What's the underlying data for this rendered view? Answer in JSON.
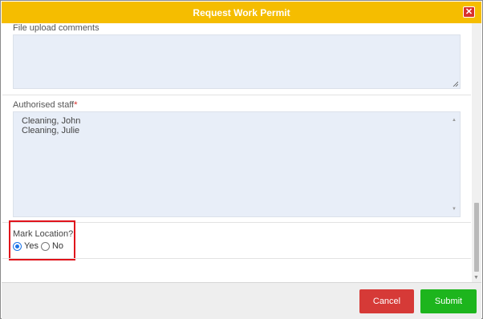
{
  "dialog": {
    "title": "Request Work Permit",
    "close_symbol": "✕"
  },
  "form": {
    "file_upload_comments": {
      "label": "File upload comments",
      "value": ""
    },
    "authorised_staff": {
      "label": "Authorised staff",
      "required_marker": "*",
      "values": [
        "Cleaning, John",
        "Cleaning, Julie"
      ]
    },
    "mark_location": {
      "label": "Mark Location?",
      "options": [
        {
          "label": "Yes",
          "selected": true
        },
        {
          "label": "No",
          "selected": false
        }
      ]
    }
  },
  "footer": {
    "cancel_label": "Cancel",
    "submit_label": "Submit"
  },
  "colors": {
    "title_bar": "#f5bd00",
    "cancel": "#d63a37",
    "submit": "#1db51d",
    "highlight": "#e0131b",
    "field_background": "#e8eef8"
  }
}
